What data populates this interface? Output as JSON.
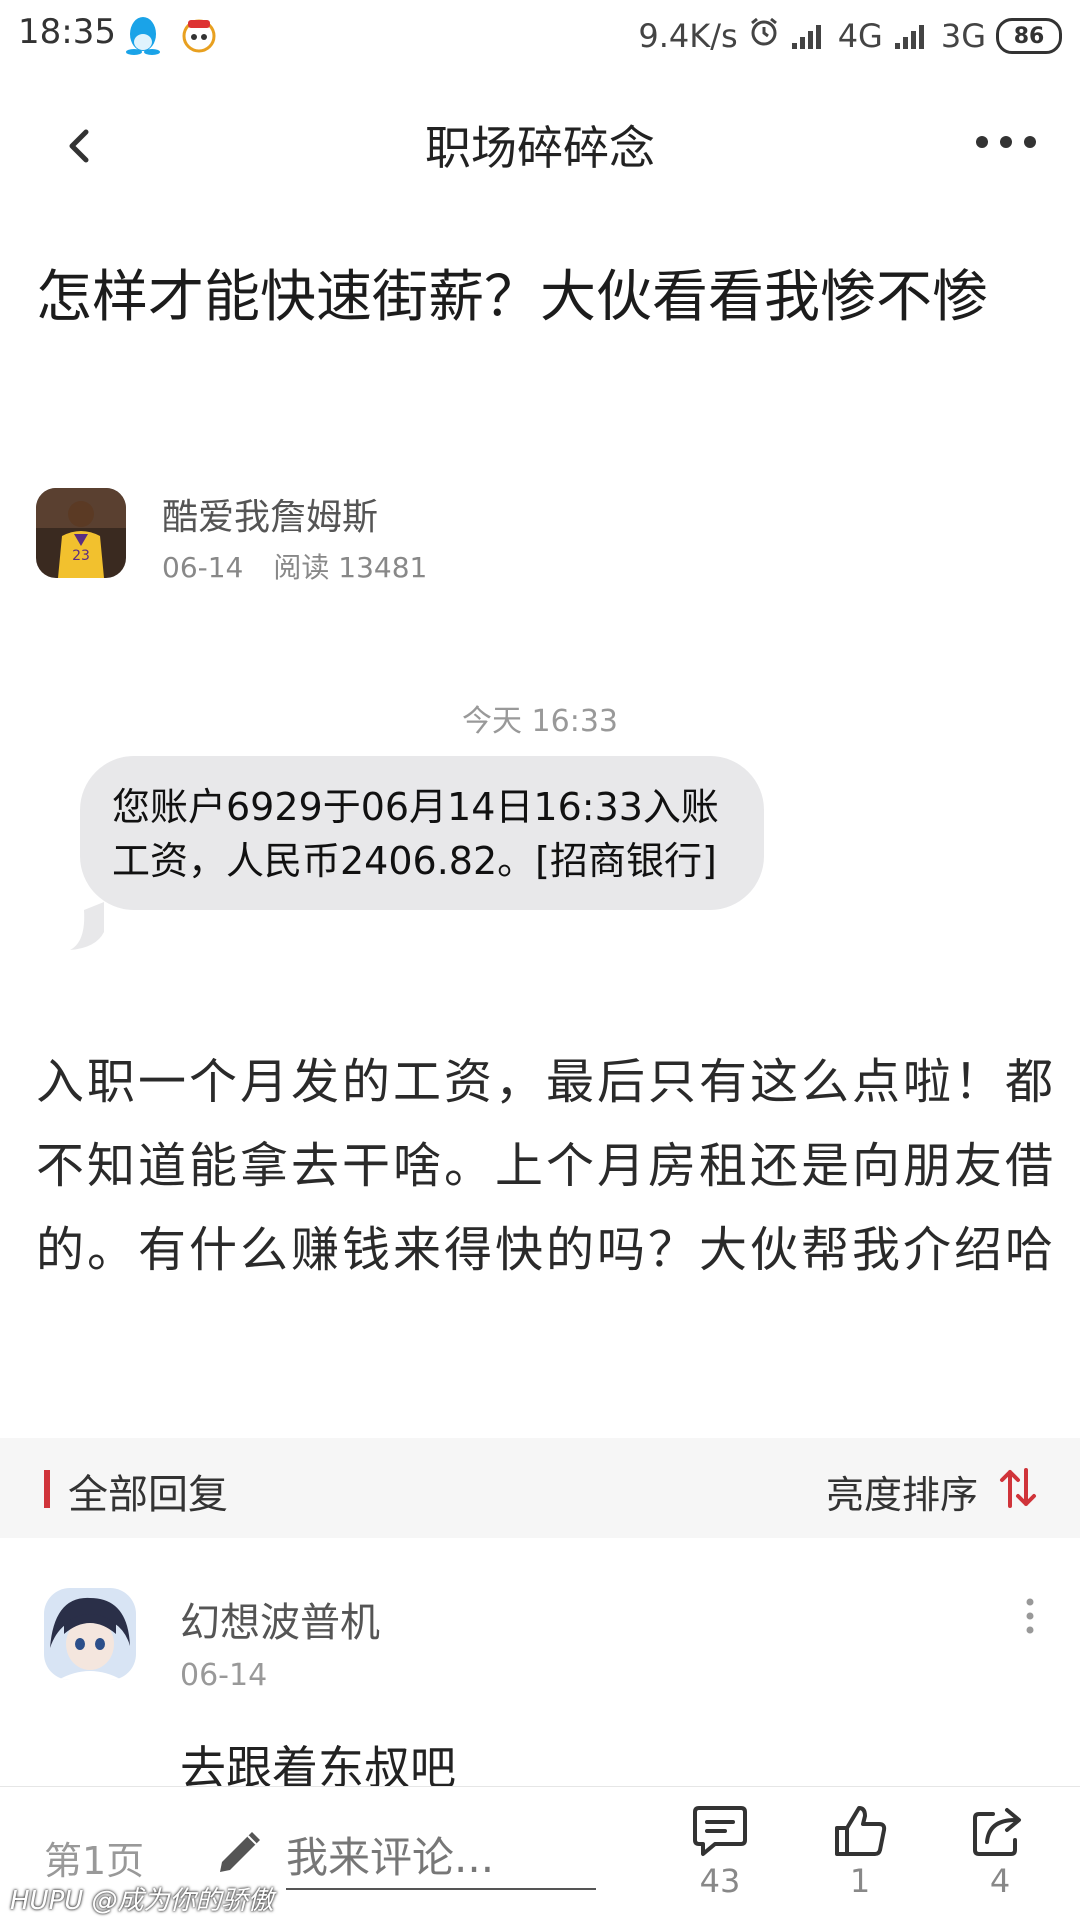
{
  "status_bar": {
    "time": "18:35",
    "net_speed": "9.4K/s",
    "network_1": "4G",
    "network_2": "3G",
    "battery": "86",
    "icons": [
      "qq-penguin-icon",
      "app-notification-icon",
      "alarm-icon",
      "signal-icon",
      "battery-icon"
    ]
  },
  "nav": {
    "title": "职场碎碎念",
    "back_icon": "chevron-left-icon",
    "more_icon": "more-dots-icon"
  },
  "post": {
    "title": "怎样才能快速街薪？大伙看看我惨不惨",
    "author": "酷爱我詹姆斯",
    "date": "06-14",
    "views": "阅读 13481",
    "sms_time": "今天 16:33",
    "sms_text": "您账户6929于06月14日16:33入账工资，人民币2406.82。[招商银行]",
    "body": "入职一个月发的工资，最后只有这么点啦！都不知道能拿去干啥。上个月房租还是向朋友借的。有什么赚钱来得快的吗？大伙帮我介绍哈"
  },
  "replies": {
    "header": "全部回复",
    "sort_label": "亮度排序",
    "items": [
      {
        "user": "幻想波普机",
        "date": "06-14",
        "text": "去跟着东叔吧"
      }
    ]
  },
  "bottom_bar": {
    "page": "第1页",
    "comment_placeholder": "我来评论...",
    "comments_count": "43",
    "likes_count": "1",
    "shares_count": "4"
  },
  "watermark": "HUPU @成为你的骄傲",
  "colors": {
    "accent_red": "#d0343a",
    "bubble_gray": "#e8e8ea",
    "replies_bg": "#f6f6f6"
  }
}
